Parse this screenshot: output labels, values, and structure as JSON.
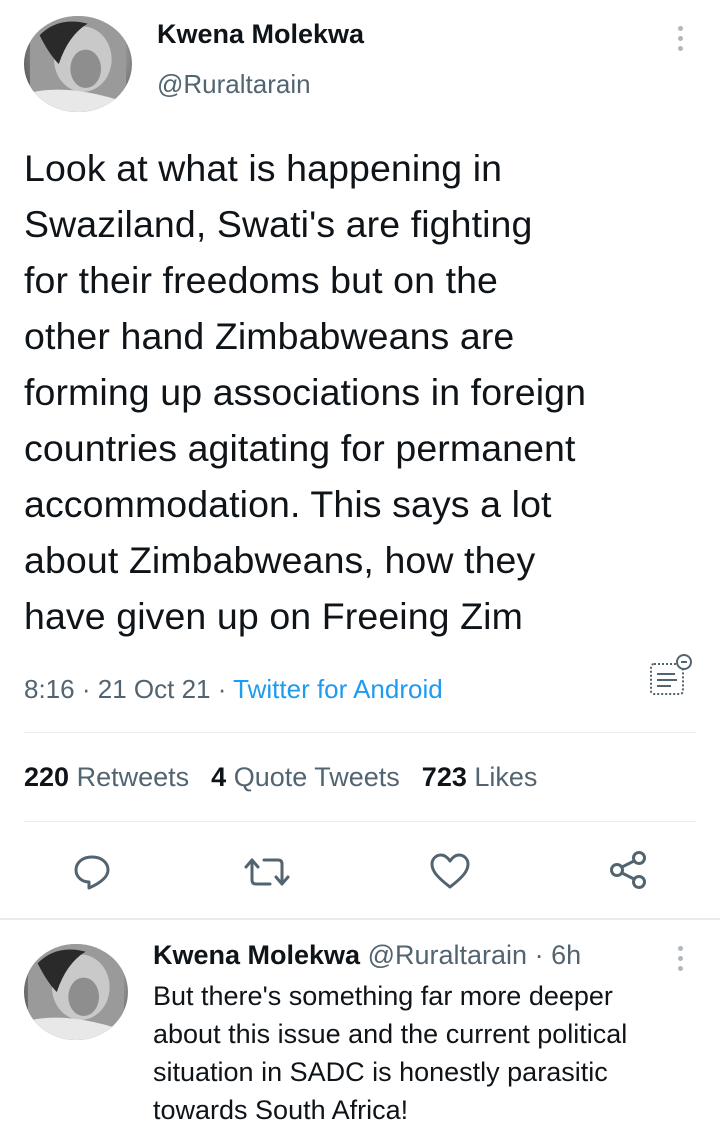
{
  "tweet": {
    "author_name": "Kwena Molekwa",
    "author_handle": "@Ruraltarain",
    "text": "Look at what is happening in\nSwaziland, Swati's are fighting\nfor their freedoms but on the\nother hand Zimbabweans are\nforming up associations in foreign\ncountries agitating for permanent\naccommodation. This says a lot\nabout Zimbabweans, how they\nhave given up on Freeing Zim",
    "time": "8:16",
    "date": "21 Oct 21",
    "separator": "·",
    "source": "Twitter for Android"
  },
  "stats": {
    "retweets_count": "220",
    "retweets_label": "Retweets",
    "quotes_count": "4",
    "quotes_label": "Quote Tweets",
    "likes_count": "723",
    "likes_label": "Likes"
  },
  "actions": {
    "icons": [
      "reply-icon",
      "retweet-icon",
      "like-icon",
      "share-icon"
    ]
  },
  "reply": {
    "author_name": "Kwena Molekwa",
    "author_handle": "@Ruraltarain",
    "separator": "·",
    "age": "6h",
    "text": "But there's something far more deeper\nabout this issue and the current political\nsituation in SADC is honestly parasitic\ntowards South Africa!"
  },
  "colors": {
    "text": "#0f1419",
    "secondary": "#536471",
    "link": "#1d9bf0",
    "divider": "#e6ecf0"
  }
}
